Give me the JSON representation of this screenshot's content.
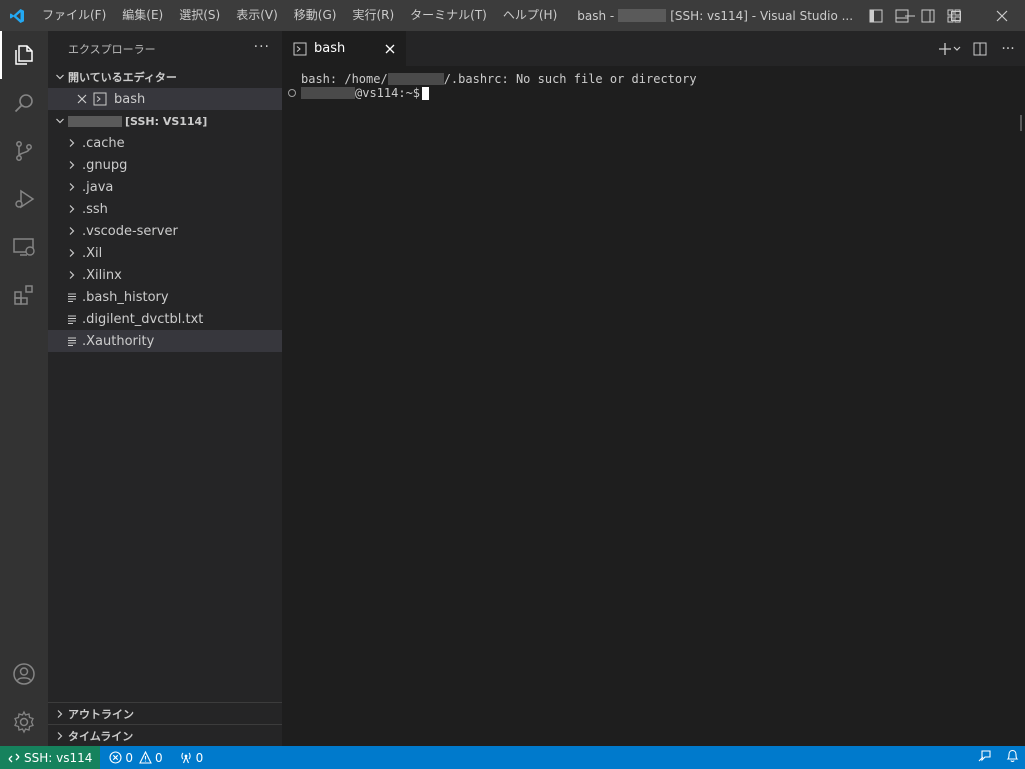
{
  "titlebar": {
    "menu": [
      "ファイル(F)",
      "編集(E)",
      "選択(S)",
      "表示(V)",
      "移動(G)",
      "実行(R)",
      "ターミナル(T)",
      "ヘルプ(H)"
    ],
    "title_prefix": "bash -",
    "title_suffix": "[SSH: vs114] - Visual Studio ..."
  },
  "activitybar": {
    "items": [
      "explorer-icon",
      "search-icon",
      "source-control-icon",
      "run-debug-icon",
      "remote-explorer-icon",
      "extensions-icon"
    ],
    "bottom": [
      "account-icon",
      "manage-gear-icon"
    ]
  },
  "sidebar": {
    "header": "エクスプローラー",
    "more": "···",
    "open_editors": {
      "title": "開いているエディター",
      "items": [
        {
          "label": "bash"
        }
      ]
    },
    "workspace": {
      "title": "[SSH: VS114]",
      "folders": [
        ".cache",
        ".gnupg",
        ".java",
        ".ssh",
        ".vscode-server",
        ".Xil",
        ".Xilinx"
      ],
      "files": [
        ".bash_history",
        ".digilent_dvctbl.txt",
        ".Xauthority"
      ],
      "selected": ".Xauthority"
    },
    "outline": "アウトライン",
    "timeline": "タイムライン"
  },
  "editor": {
    "tab": {
      "label": "bash"
    },
    "terminal": {
      "line1_pre": "bash: /home/",
      "line1_post": "/.bashrc: No such file or directory",
      "prompt_post": "@vs114:~$"
    }
  },
  "statusbar": {
    "remote": "SSH: vs114",
    "errors": "0",
    "warnings": "0",
    "ports": "0"
  },
  "colors": {
    "statusbar": "#007acc",
    "remote": "#16825d",
    "titlebar": "#3c3c3c",
    "activitybar": "#333333",
    "sidebar": "#252526",
    "editor": "#1e1e1e"
  }
}
